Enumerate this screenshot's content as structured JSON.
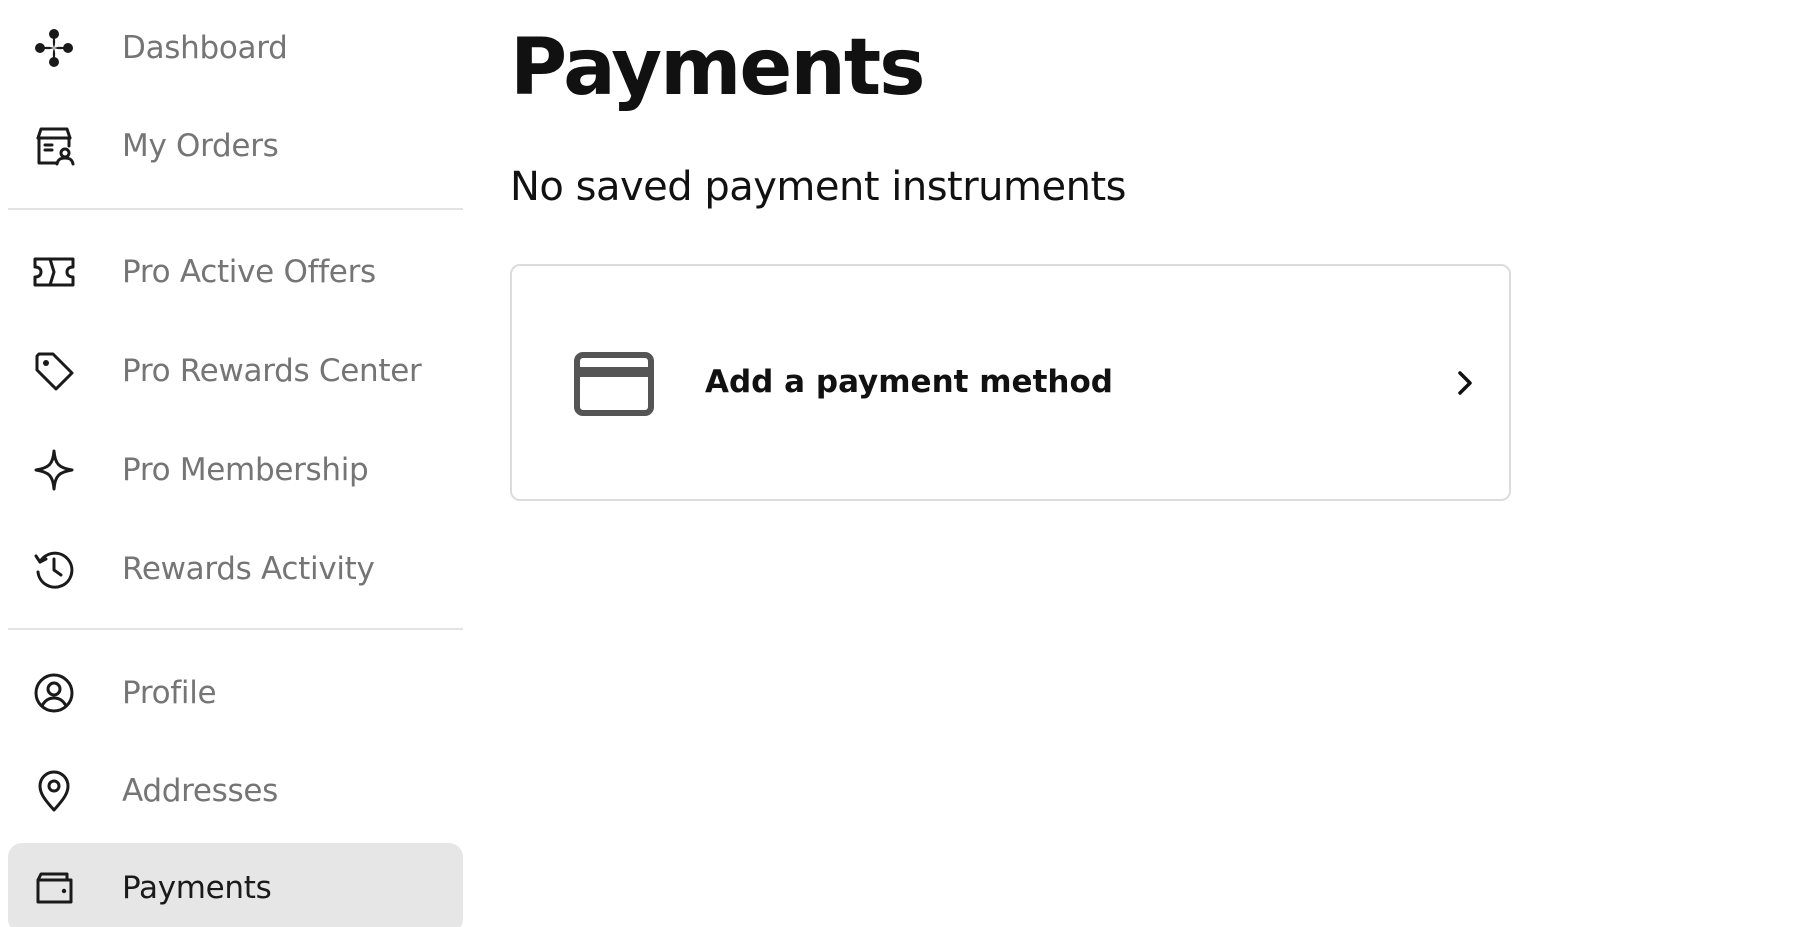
{
  "sidebar": {
    "items": [
      {
        "label": "Dashboard",
        "icon": "sparkle-icon",
        "active": false
      },
      {
        "label": "My Orders",
        "icon": "store-user-icon",
        "active": false
      },
      {
        "label": "Pro Active Offers",
        "icon": "ticket-icon",
        "active": false
      },
      {
        "label": "Pro Rewards Center",
        "icon": "tag-icon",
        "active": false
      },
      {
        "label": "Pro Membership",
        "icon": "star-outline-icon",
        "active": false
      },
      {
        "label": "Rewards Activity",
        "icon": "history-icon",
        "active": false
      },
      {
        "label": "Profile",
        "icon": "user-circle-icon",
        "active": false
      },
      {
        "label": "Addresses",
        "icon": "location-pin-icon",
        "active": false
      },
      {
        "label": "Payments",
        "icon": "wallet-icon",
        "active": true
      }
    ]
  },
  "main": {
    "title": "Payments",
    "empty_message": "No saved payment instruments",
    "add_card": {
      "label": "Add a payment method",
      "icon": "credit-card-icon",
      "chevron": "chevron-right-icon"
    }
  },
  "colors": {
    "active_bg": "#e6e6e6",
    "muted_text": "#757575",
    "text": "#111111",
    "border": "#dcdcdc",
    "icon": "#1a1a1a",
    "card_icon": "#555555"
  }
}
